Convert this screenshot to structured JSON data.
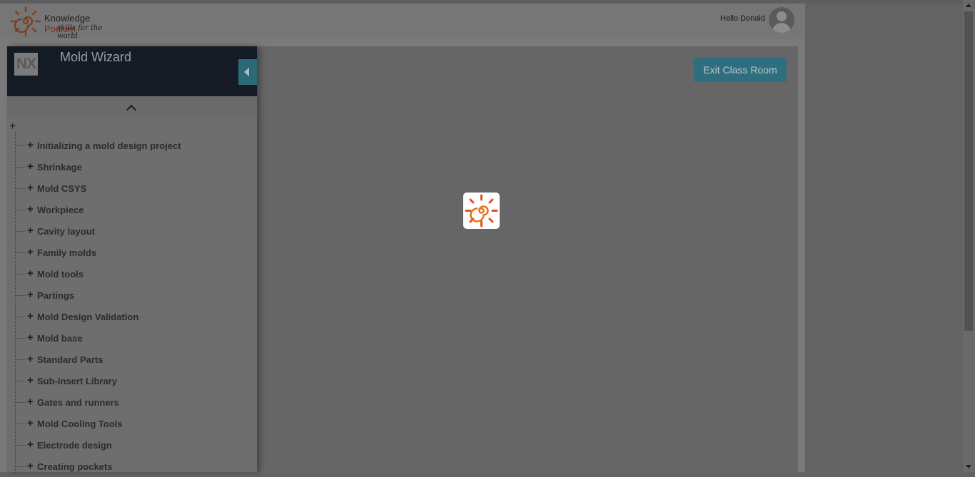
{
  "header": {
    "logo": {
      "brand_part1": "Knowledge ",
      "brand_part2": "Podium",
      "tagline": "skills for the world"
    },
    "greeting": "Hello Donald"
  },
  "sidebar": {
    "badge": "NX",
    "course_title": "Mold Wizard",
    "root_toggle": "+",
    "items": [
      {
        "label": "Initializing a mold design project"
      },
      {
        "label": "Shrinkage"
      },
      {
        "label": "Mold CSYS"
      },
      {
        "label": "Workpiece"
      },
      {
        "label": "Cavity layout"
      },
      {
        "label": "Family molds"
      },
      {
        "label": "Mold tools"
      },
      {
        "label": "Partings"
      },
      {
        "label": "Mold Design Validation"
      },
      {
        "label": "Mold base"
      },
      {
        "label": "Standard Parts"
      },
      {
        "label": "Sub-insert Library"
      },
      {
        "label": "Gates and runners"
      },
      {
        "label": "Mold Cooling Tools"
      },
      {
        "label": "Electrode design"
      },
      {
        "label": "Creating pockets"
      }
    ]
  },
  "main": {
    "exit_button": "Exit Class Room"
  },
  "colors": {
    "sidebar_header": "#141b24",
    "accent_button": "#2e6e7e",
    "logo_orange": "#e8731a",
    "logo_red": "#c0361a"
  }
}
